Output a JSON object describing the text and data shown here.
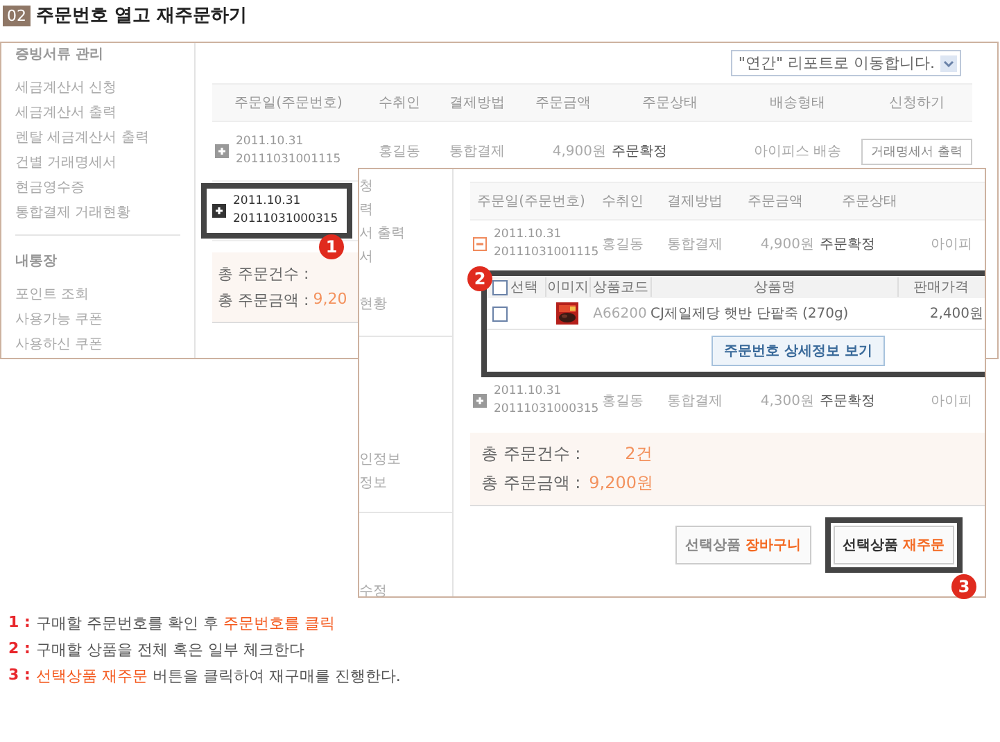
{
  "title": {
    "number": "02",
    "text": "주문번호 열고 재주문하기"
  },
  "back_panel": {
    "sidebar": [
      {
        "heading": "증빙서류 관리",
        "items": [
          "세금계산서 신청",
          "세금계산서 출력",
          "렌탈 세금계산서 출력",
          "건별 거래명세서",
          "현금영수증",
          "통합결제 거래현황"
        ]
      },
      {
        "heading": "내통장",
        "items": [
          "포인트 조회",
          "사용가능 쿠폰",
          "사용하신 쿠폰"
        ]
      }
    ],
    "report_select": {
      "value": "\"연간\" 리포트로 이동합니다."
    },
    "columns": [
      "주문일(주문번호)",
      "수취인",
      "결제방법",
      "주문금액",
      "주문상태",
      "배송형태",
      "신청하기"
    ],
    "rows": [
      {
        "expanded": false,
        "date": "2011.10.31",
        "order_no": "20111031001115",
        "recipient": "홍길동",
        "payment": "통합결제",
        "amount": "4,900원",
        "status": "주문확정",
        "delivery": "아이피스 배송",
        "action": "거래명세서 출력"
      },
      {
        "expanded": false,
        "date": "2011.10.31",
        "order_no": "20111031000315"
      }
    ],
    "summary": {
      "count_label": "총 주문건수 :",
      "amount_label": "총 주문금액 :",
      "amount": "9,20"
    }
  },
  "front_panel": {
    "sidebar_fragments": [
      "청",
      "력",
      "서 출력",
      "서",
      "현황",
      "인정보",
      "정보",
      "수정"
    ],
    "columns": [
      "주문일(주문번호)",
      "수취인",
      "결제방법",
      "주문금액",
      "주문상태"
    ],
    "rows": [
      {
        "expanded": true,
        "date": "2011.10.31",
        "order_no": "20111031001115",
        "recipient": "홍길동",
        "payment": "통합결제",
        "amount": "4,900원",
        "status": "주문확정",
        "delivery": "아이피"
      },
      {
        "expanded": false,
        "date": "2011.10.31",
        "order_no": "20111031000315",
        "recipient": "홍길동",
        "payment": "통합결제",
        "amount": "4,300원",
        "status": "주문확정",
        "delivery": "아이피"
      }
    ],
    "detail": {
      "columns": [
        "선택",
        "이미지",
        "상품코드",
        "상품명",
        "판매가격"
      ],
      "all_checked": false,
      "items": [
        {
          "checked": false,
          "code": "A66200",
          "name": "CJ제일제당 햇반 단팥죽 (270g)",
          "price": "2,400원"
        }
      ],
      "detail_button": "주문번호 상세정보 보기"
    },
    "summary": {
      "count_label": "총 주문건수 :",
      "count": "2건",
      "amount_label": "총 주문금액 :",
      "amount": "9,200원"
    },
    "buttons": [
      "선택상품 **장바구니**",
      "선택상품 **재주문**"
    ]
  },
  "callouts": [
    "1",
    "2",
    "3"
  ],
  "instructions": [
    {
      "number": "1 :",
      "text": "구매할 주문번호를 확인 후 **주문번호를 클릭**"
    },
    {
      "number": "2 :",
      "text": "구매할 상품을 전체 혹은 일부 체크한다"
    },
    {
      "number": "3 :",
      "text": "**선택상품 재주문** 버튼을 클릭하여 재구매를 진행한다."
    }
  ]
}
